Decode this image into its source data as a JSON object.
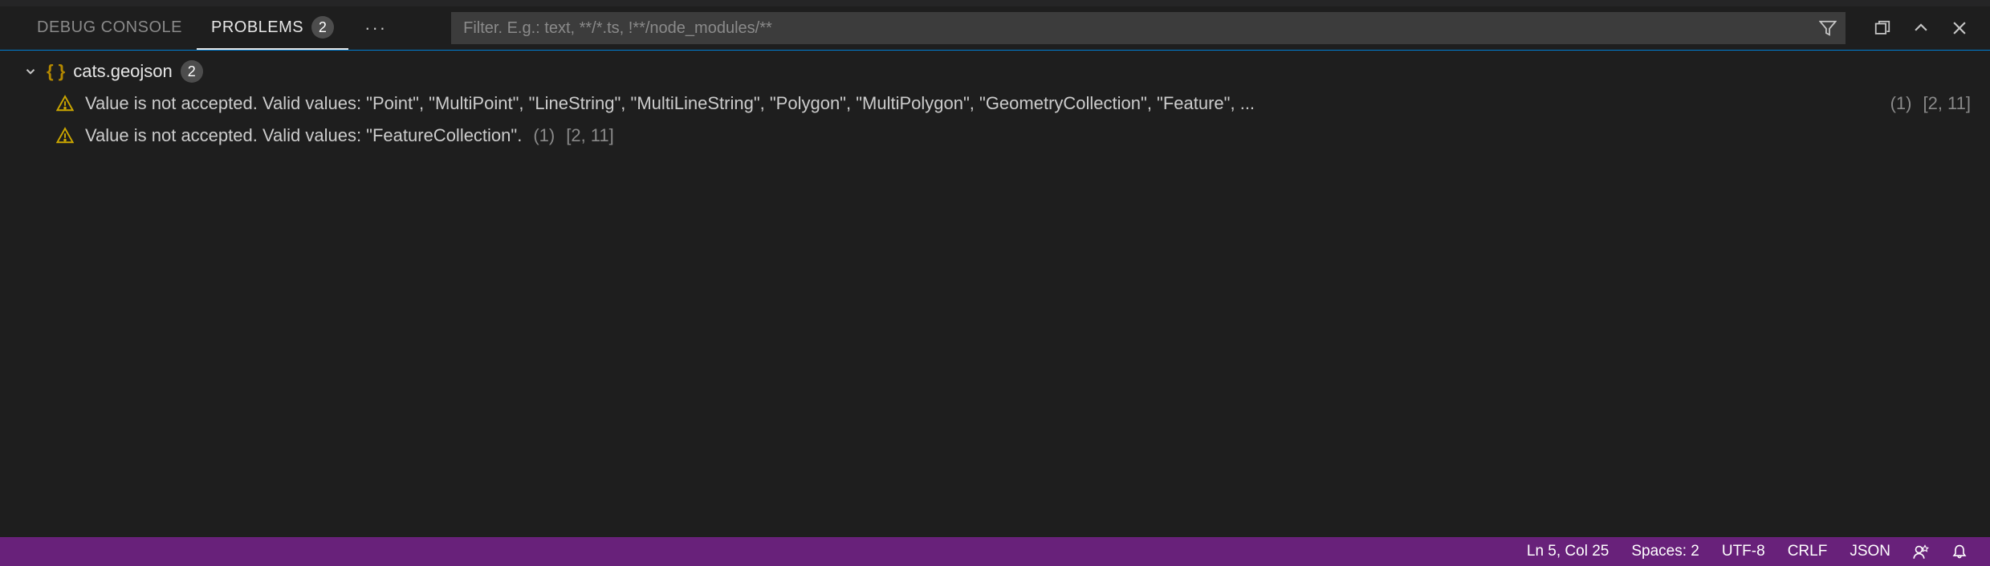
{
  "tabs": {
    "debug_console": "DEBUG CONSOLE",
    "problems": "PROBLEMS",
    "problems_count": "2"
  },
  "filter": {
    "placeholder": "Filter. E.g.: text, **/*.ts, !**/node_modules/**"
  },
  "file": {
    "name": "cats.geojson",
    "count": "2"
  },
  "problems": [
    {
      "message": "Value is not accepted. Valid values: \"Point\", \"MultiPoint\", \"LineString\", \"MultiLineString\", \"Polygon\", \"MultiPolygon\", \"GeometryCollection\", \"Feature\", ...",
      "source_count": "(1)",
      "location": "[2, 11]",
      "truncated": true
    },
    {
      "message": "Value is not accepted. Valid values: \"FeatureCollection\".",
      "source_count": "(1)",
      "location": "[2, 11]",
      "truncated": false
    }
  ],
  "status": {
    "ln_col": "Ln 5, Col 25",
    "spaces": "Spaces: 2",
    "encoding": "UTF-8",
    "eol": "CRLF",
    "language": "JSON"
  }
}
